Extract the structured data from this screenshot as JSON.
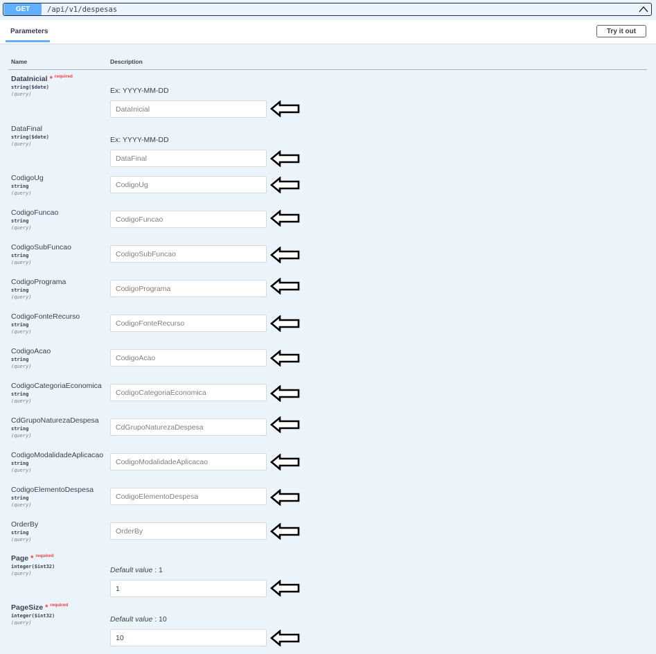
{
  "endpoint": {
    "method": "GET",
    "path": "/api/v1/despesas"
  },
  "tabs": {
    "parameters": "Parameters"
  },
  "try_it_out": "Try it out",
  "columns": {
    "name": "Name",
    "description": "Description"
  },
  "required_label": "required",
  "params": [
    {
      "name": "DataInicial",
      "required": true,
      "type": "string($date)",
      "in": "(query)",
      "desc": "Ex: YYYY-MM-DD",
      "placeholder": "DataInicial",
      "value": ""
    },
    {
      "name": "DataFinal",
      "required": false,
      "type": "string($date)",
      "in": "(query)",
      "desc": "Ex: YYYY-MM-DD",
      "placeholder": "DataFinal",
      "value": ""
    },
    {
      "name": "CodigoUg",
      "required": false,
      "type": "string",
      "in": "(query)",
      "placeholder": "CodigoUg",
      "value": ""
    },
    {
      "name": "CodigoFuncao",
      "required": false,
      "type": "string",
      "in": "(query)",
      "placeholder": "CodigoFuncao",
      "value": ""
    },
    {
      "name": "CodigoSubFuncao",
      "required": false,
      "type": "string",
      "in": "(query)",
      "placeholder": "CodigoSubFuncao",
      "value": ""
    },
    {
      "name": "CodigoPrograma",
      "required": false,
      "type": "string",
      "in": "(query)",
      "placeholder": "CodigoPrograma",
      "value": ""
    },
    {
      "name": "CodigoFonteRecurso",
      "required": false,
      "type": "string",
      "in": "(query)",
      "placeholder": "CodigoFonteRecurso",
      "value": ""
    },
    {
      "name": "CodigoAcao",
      "required": false,
      "type": "string",
      "in": "(query)",
      "placeholder": "CodigoAcao",
      "value": ""
    },
    {
      "name": "CodigoCategoriaEconomica",
      "required": false,
      "type": "string",
      "in": "(query)",
      "placeholder": "CodigoCategoriaEconomica",
      "value": ""
    },
    {
      "name": "CdGrupoNaturezaDespesa",
      "required": false,
      "type": "string",
      "in": "(query)",
      "placeholder": "CdGrupoNaturezaDespesa",
      "value": ""
    },
    {
      "name": "CodigoModalidadeAplicacao",
      "required": false,
      "type": "string",
      "in": "(query)",
      "placeholder": "CodigoModalidadeAplicacao",
      "value": ""
    },
    {
      "name": "CodigoElementoDespesa",
      "required": false,
      "type": "string",
      "in": "(query)",
      "placeholder": "CodigoElementoDespesa",
      "value": ""
    },
    {
      "name": "OrderBy",
      "required": false,
      "type": "string",
      "in": "(query)",
      "placeholder": "OrderBy",
      "value": ""
    },
    {
      "name": "Page",
      "required": true,
      "type": "integer($int32)",
      "in": "(query)",
      "default_label": "Default value",
      "default_value": ": 1",
      "placeholder": "",
      "value": "1"
    },
    {
      "name": "PageSize",
      "required": true,
      "type": "integer($int32)",
      "in": "(query)",
      "default_label": "Default value",
      "default_value": ": 10",
      "placeholder": "",
      "value": "10"
    }
  ],
  "colors": {
    "get": "#61affe",
    "required": "#f93e3e",
    "background": "#ebf3fb"
  },
  "icons": {
    "collapse": "chevron-up-icon",
    "pointer": "left-arrow-icon"
  }
}
